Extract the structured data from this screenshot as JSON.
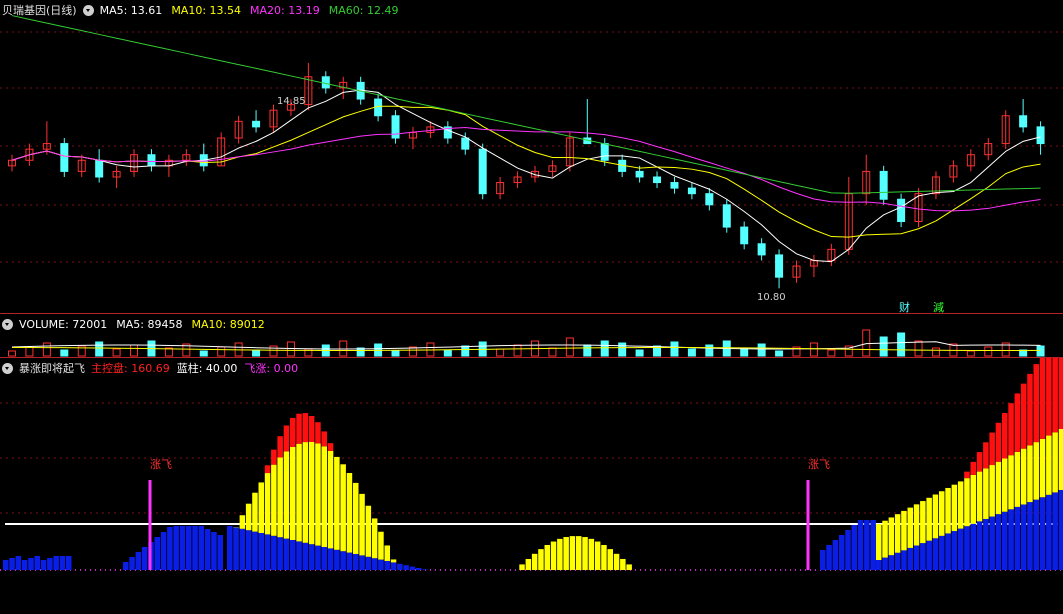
{
  "price_panel": {
    "title": "贝瑞基因(日线)",
    "ma_labels": [
      {
        "text": "MA5: 13.61",
        "color": "#ffffff"
      },
      {
        "text": "MA10: 13.54",
        "color": "#ffff00"
      },
      {
        "text": "MA20: 13.19",
        "color": "#ff33ff"
      },
      {
        "text": "MA60: 12.49",
        "color": "#33cc33"
      }
    ],
    "high_marker": "14.85",
    "low_marker": "10.80",
    "tag_cai": "财",
    "tag_jian": "減"
  },
  "volume_panel": {
    "labels": [
      {
        "text": "VOLUME: 72001",
        "color": "#ffffff"
      },
      {
        "text": "MA5: 89458",
        "color": "#ffffff"
      },
      {
        "text": "MA10: 89012",
        "color": "#ffff00"
      }
    ]
  },
  "indicator_panel": {
    "title": "暴涨即将起飞",
    "labels": [
      {
        "text": "主控盘: 160.69",
        "color": "#ff2020"
      },
      {
        "text": "蓝柱: 40.00",
        "color": "#ffffff"
      },
      {
        "text": "飞涨: 0.00",
        "color": "#ff33ff"
      }
    ],
    "signal_text": "涨飞"
  },
  "colors": {
    "up": "#ff3030",
    "down": "#54ffff",
    "ma5": "#ffffff",
    "ma10": "#ffff00",
    "ma20": "#ff33ff",
    "ma60": "#33cc33",
    "bar_blue": "#0a1ee6",
    "bar_yellow": "#ffff00",
    "bar_red": "#ff1010",
    "signal": "#ff33ff"
  },
  "chart_data": {
    "type": "candlestick",
    "y_range": [
      10.5,
      15.8
    ],
    "candles": [
      [
        13.0,
        13.2,
        12.9,
        13.1
      ],
      [
        13.1,
        13.4,
        13.0,
        13.3
      ],
      [
        13.3,
        13.8,
        13.2,
        13.4
      ],
      [
        13.4,
        13.5,
        12.8,
        12.9
      ],
      [
        12.9,
        13.2,
        12.8,
        13.1
      ],
      [
        13.1,
        13.3,
        12.7,
        12.8
      ],
      [
        12.8,
        13.0,
        12.6,
        12.9
      ],
      [
        12.9,
        13.3,
        12.8,
        13.2
      ],
      [
        13.2,
        13.3,
        12.9,
        13.0
      ],
      [
        13.0,
        13.2,
        12.8,
        13.1
      ],
      [
        13.1,
        13.3,
        13.0,
        13.2
      ],
      [
        13.2,
        13.4,
        12.9,
        13.0
      ],
      [
        13.0,
        13.6,
        13.0,
        13.5
      ],
      [
        13.5,
        13.9,
        13.4,
        13.8
      ],
      [
        13.8,
        14.0,
        13.6,
        13.7
      ],
      [
        13.7,
        14.1,
        13.6,
        14.0
      ],
      [
        14.0,
        14.2,
        13.9,
        14.1
      ],
      [
        14.1,
        14.85,
        14.0,
        14.6
      ],
      [
        14.6,
        14.7,
        14.3,
        14.4
      ],
      [
        14.4,
        14.6,
        14.2,
        14.5
      ],
      [
        14.5,
        14.6,
        14.1,
        14.2
      ],
      [
        14.2,
        14.3,
        13.8,
        13.9
      ],
      [
        13.9,
        14.0,
        13.4,
        13.5
      ],
      [
        13.5,
        13.7,
        13.3,
        13.6
      ],
      [
        13.6,
        13.8,
        13.5,
        13.7
      ],
      [
        13.7,
        13.8,
        13.4,
        13.5
      ],
      [
        13.5,
        13.6,
        13.2,
        13.3
      ],
      [
        13.3,
        13.4,
        12.4,
        12.5
      ],
      [
        12.5,
        12.8,
        12.4,
        12.7
      ],
      [
        12.7,
        12.9,
        12.6,
        12.8
      ],
      [
        12.8,
        13.0,
        12.7,
        12.9
      ],
      [
        12.9,
        13.1,
        12.8,
        13.0
      ],
      [
        13.0,
        13.6,
        12.9,
        13.5
      ],
      [
        13.5,
        14.2,
        13.4,
        13.4
      ],
      [
        13.4,
        13.5,
        13.0,
        13.1
      ],
      [
        13.1,
        13.2,
        12.8,
        12.9
      ],
      [
        12.9,
        13.0,
        12.7,
        12.8
      ],
      [
        12.8,
        12.9,
        12.6,
        12.7
      ],
      [
        12.7,
        12.8,
        12.5,
        12.6
      ],
      [
        12.6,
        12.7,
        12.4,
        12.5
      ],
      [
        12.5,
        12.6,
        12.2,
        12.3
      ],
      [
        12.3,
        12.4,
        11.8,
        11.9
      ],
      [
        11.9,
        12.0,
        11.5,
        11.6
      ],
      [
        11.6,
        11.7,
        11.3,
        11.4
      ],
      [
        11.4,
        11.5,
        10.8,
        11.0
      ],
      [
        11.0,
        11.3,
        10.9,
        11.2
      ],
      [
        11.2,
        11.4,
        11.0,
        11.3
      ],
      [
        11.3,
        11.6,
        11.2,
        11.5
      ],
      [
        11.5,
        12.8,
        11.4,
        12.5
      ],
      [
        12.5,
        13.2,
        12.3,
        12.9
      ],
      [
        12.9,
        13.0,
        12.3,
        12.4
      ],
      [
        12.4,
        12.5,
        11.9,
        12.0
      ],
      [
        12.0,
        12.6,
        11.9,
        12.5
      ],
      [
        12.5,
        12.9,
        12.4,
        12.8
      ],
      [
        12.8,
        13.1,
        12.7,
        13.0
      ],
      [
        13.0,
        13.3,
        12.9,
        13.2
      ],
      [
        13.2,
        13.5,
        13.1,
        13.4
      ],
      [
        13.4,
        14.0,
        13.3,
        13.9
      ],
      [
        13.9,
        14.2,
        13.6,
        13.7
      ],
      [
        13.7,
        13.8,
        13.2,
        13.4
      ]
    ]
  }
}
